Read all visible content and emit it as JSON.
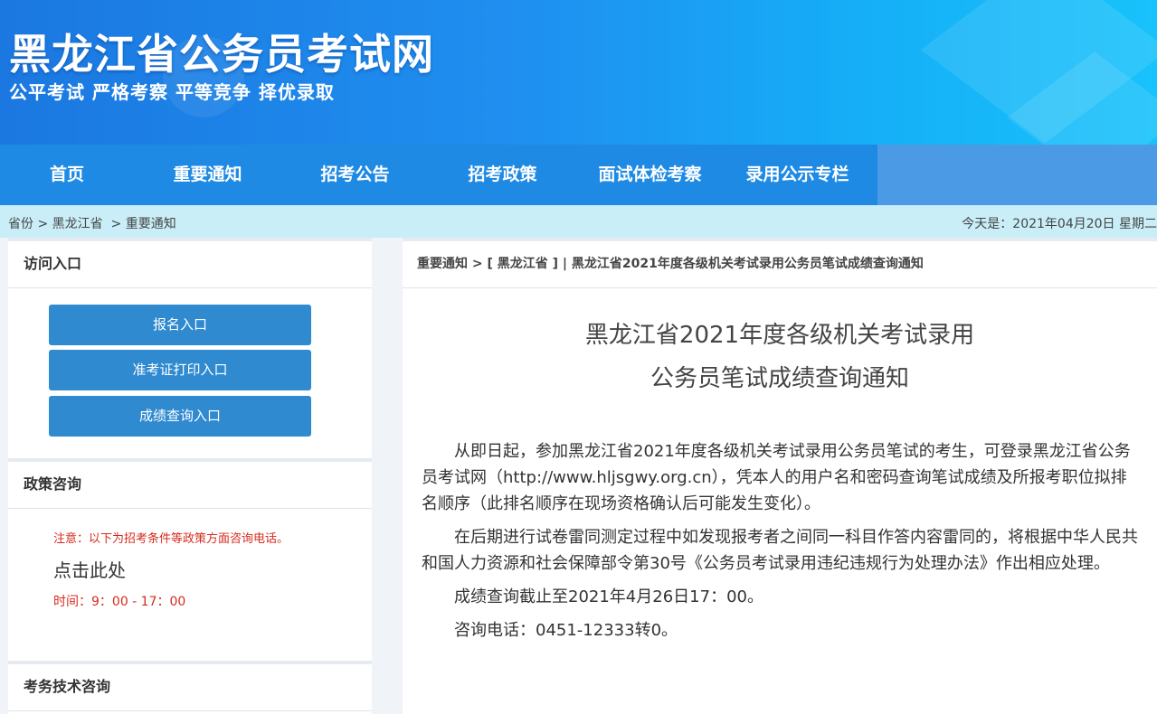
{
  "header": {
    "site_title": "黑龙江省公务员考试网",
    "slogan": "公平考试 严格考察 平等竞争 择优录取"
  },
  "nav": {
    "items": [
      {
        "label": "首页"
      },
      {
        "label": "重要通知"
      },
      {
        "label": "招考公告"
      },
      {
        "label": "招考政策"
      },
      {
        "label": "面试体检考察"
      },
      {
        "label": "录用公示专栏"
      }
    ]
  },
  "breadcrumb": {
    "items": [
      "省份",
      ">",
      "黑龙江省",
      ">",
      "重要通知"
    ],
    "today": "今天是：2021年04月20日 星期二"
  },
  "sidebar": {
    "entry_panel": {
      "title": "访问入口",
      "buttons": [
        "报名入口",
        "准考证打印入口",
        "成绩查询入口"
      ]
    },
    "policy_panel": {
      "title": "政策咨询",
      "note": "注意：以下为招考条件等政策方面咨询电话。",
      "link": "点击此处",
      "time": "时间：9：00 - 17：00"
    },
    "tech_panel": {
      "title": "考务技术咨询"
    }
  },
  "article": {
    "crumb": {
      "section": "重要通知",
      "sep1": " > ",
      "region": "[ 黑龙江省 ]",
      "sep2": " | ",
      "title": "黑龙江省2021年度各级机关考试录用公务员笔试成绩查询通知"
    },
    "title_line1": "黑龙江省2021年度各级机关考试录用",
    "title_line2": "公务员笔试成绩查询通知",
    "paragraphs": [
      "从即日起，参加黑龙江省2021年度各级机关考试录用公务员笔试的考生，可登录黑龙江省公务员考试网（http://www.hljsgwy.org.cn），凭本人的用户名和密码查询笔试成绩及所报考职位拟排名顺序（此排名顺序在现场资格确认后可能发生变化）。",
      "在后期进行试卷雷同测定过程中如发现报考者之间同一科目作答内容雷同的，将根据中华人民共和国人力资源和社会保障部令第30号《公务员考试录用违纪违规行为处理办法》作出相应处理。",
      "成绩查询截止至2021年4月26日17：00。",
      "咨询电话：0451-12333转0。"
    ]
  },
  "colors": {
    "nav_bg": "#1f8ae4",
    "button_bg": "#2f8ad0",
    "crumb_bg": "#c9eef8",
    "notice_red": "#d52b1e"
  }
}
